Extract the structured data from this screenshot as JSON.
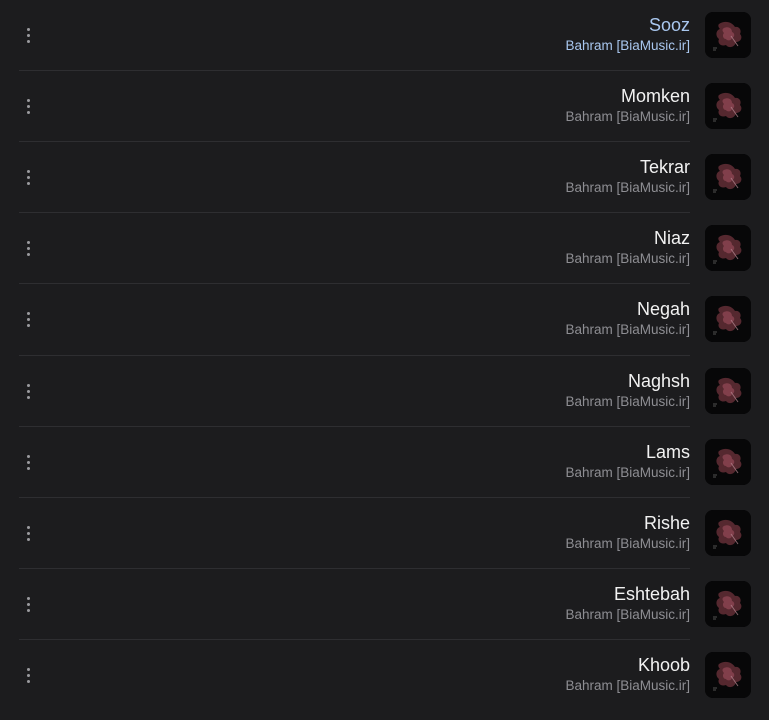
{
  "theme": {
    "background": "#1c1c1e",
    "active_color": "#a9c7ef",
    "secondary_text": "#8e8e93",
    "divider": "#2e2e31"
  },
  "track_list": {
    "more_icon": "more-vert-icon",
    "artwork_icon": "album-artwork",
    "tracks": [
      {
        "title": "Sooz",
        "artist": "Bahram [BiaMusic.ir]",
        "active": true
      },
      {
        "title": "Momken",
        "artist": "Bahram [BiaMusic.ir]",
        "active": false
      },
      {
        "title": "Tekrar",
        "artist": "Bahram [BiaMusic.ir]",
        "active": false
      },
      {
        "title": "Niaz",
        "artist": "Bahram [BiaMusic.ir]",
        "active": false
      },
      {
        "title": "Negah",
        "artist": "Bahram [BiaMusic.ir]",
        "active": false
      },
      {
        "title": "Naghsh",
        "artist": "Bahram [BiaMusic.ir]",
        "active": false
      },
      {
        "title": "Lams",
        "artist": "Bahram [BiaMusic.ir]",
        "active": false
      },
      {
        "title": "Rishe",
        "artist": "Bahram [BiaMusic.ir]",
        "active": false
      },
      {
        "title": "Eshtebah",
        "artist": "Bahram [BiaMusic.ir]",
        "active": false
      },
      {
        "title": "Khoob",
        "artist": "Bahram [BiaMusic.ir]",
        "active": false
      }
    ]
  }
}
